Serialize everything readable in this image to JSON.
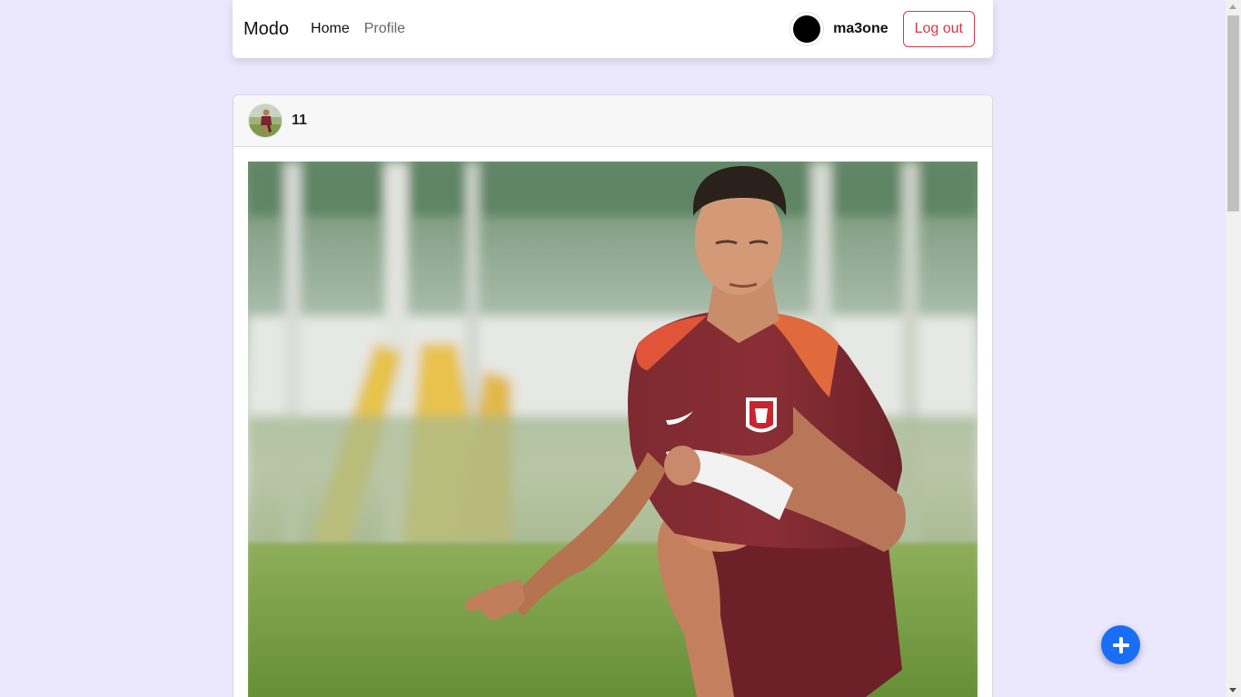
{
  "navbar": {
    "brand": "Modo",
    "links": [
      {
        "label": "Home",
        "active": true
      },
      {
        "label": "Profile",
        "active": false
      }
    ],
    "user": {
      "username": "ma3one",
      "avatar_color": "#000000"
    },
    "logout_label": "Log out",
    "logout_color": "#dc3545"
  },
  "feed": {
    "posts": [
      {
        "author": "11",
        "avatar_icon": "footballer-avatar-thumbnail",
        "image_icon": "footballer-training-photo"
      }
    ]
  },
  "fab": {
    "icon": "plus-icon",
    "color": "#1a6ef5"
  },
  "colors": {
    "page_background": "#ebe7fd"
  }
}
